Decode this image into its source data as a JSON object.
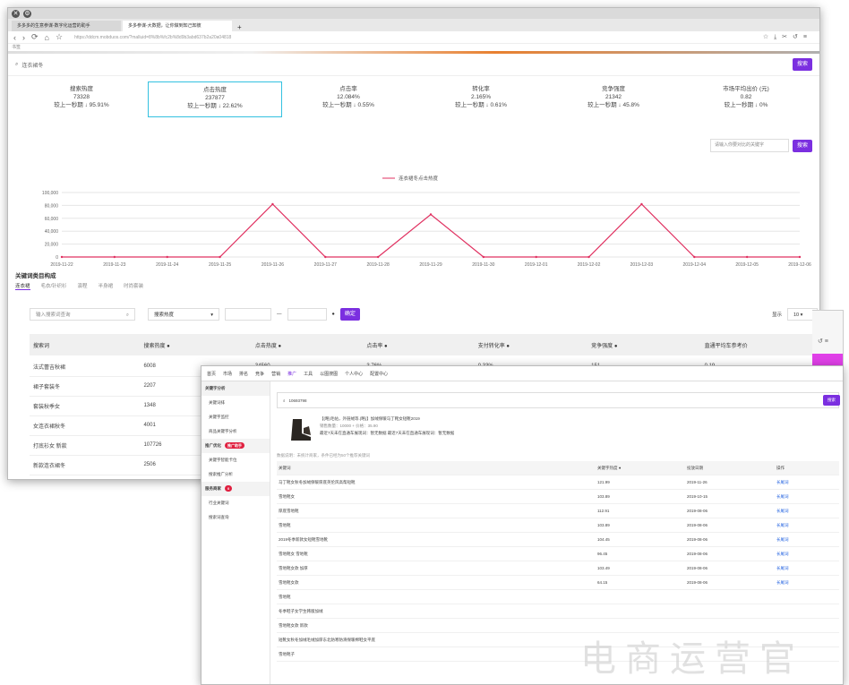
{
  "browser": {
    "tab1_title": "多多多的生意参谋-数字化运营的助手",
    "tab2_title": "多多参谋-大数据，让你做到知己知彼",
    "new_tab": "+",
    "url": "https://ddcm.mobduos.com/?malluid=8%8b%fc2b%8d9b3abd637b2a20a04818",
    "bookmark": "书签"
  },
  "search": {
    "query": "连衣裙冬",
    "button": "搜索"
  },
  "metrics": [
    {
      "label": "搜索热度",
      "value": "73328",
      "change": "较上一秒期 ↓ 95.91%"
    },
    {
      "label": "点击热度",
      "value": "237877",
      "change": "较上一秒期 ↓ 22.62%"
    },
    {
      "label": "点击率",
      "value": "12.084%",
      "change": "较上一秒期 ↓ 0.55%"
    },
    {
      "label": "转化率",
      "value": "2.165%",
      "change": "较上一秒期 ↓ 0.61%"
    },
    {
      "label": "竞争强度",
      "value": "21342",
      "change": "较上一秒期 ↓ 45.8%"
    },
    {
      "label": "市场平均出价 (元)",
      "value": "0.82",
      "change": "较上一秒期 ↓ 0%"
    }
  ],
  "compare": {
    "placeholder": "请输入你要对比的关键字",
    "button": "搜索"
  },
  "chart_data": {
    "type": "line",
    "legend": "连衣裙冬点击热度",
    "categories": [
      "2019-11-22",
      "2019-11-23",
      "2019-11-24",
      "2019-11-25",
      "2019-11-26",
      "2019-11-27",
      "2019-11-28",
      "2019-11-29",
      "2019-11-30",
      "2019-12-01",
      "2019-12-02",
      "2019-12-03",
      "2019-12-04",
      "2019-12-05",
      "2019-12-06"
    ],
    "values": [
      0,
      0,
      0,
      0,
      82000,
      0,
      0,
      66000,
      0,
      0,
      0,
      82000,
      0,
      0,
      0
    ],
    "yticks": [
      "0",
      "20,000",
      "40,000",
      "60,000",
      "80,000",
      "100,000"
    ],
    "ylim": [
      0,
      100000
    ],
    "series_color": "#e03060"
  },
  "section": {
    "title": "关键词类目构成",
    "tabs": [
      "连衣裙",
      "毛衣/针织衫",
      "演程",
      "半身裙",
      "时尚套装"
    ]
  },
  "filters": {
    "keyword_placeholder": "输入搜索词查询",
    "select_value": "搜索热度",
    "confirm": "确定",
    "show_label": "显示",
    "page_size": "10"
  },
  "table": {
    "headers": [
      "搜索词",
      "搜索热度",
      "点击热度",
      "点击率",
      "支付转化率",
      "竞争强度",
      "直通平均车参考价"
    ],
    "rows": [
      [
        "法式蕾吉秋裙",
        "6008",
        "34560",
        "3.76%",
        "0.33%",
        "151",
        "0.19"
      ],
      [
        "裙子套装冬",
        "2207",
        "",
        "",
        "",
        "",
        ""
      ],
      [
        "套装秋季女",
        "1348",
        "",
        "",
        "",
        "",
        ""
      ],
      [
        "女连衣裙秋冬",
        "4001",
        "",
        "",
        "",
        "",
        ""
      ],
      [
        "打底衫女 新款",
        "107726",
        "",
        "",
        "",
        "",
        ""
      ],
      [
        "新款连衣裙冬",
        "2506",
        "",
        "",
        "",
        "",
        ""
      ]
    ]
  },
  "w2": {
    "nav": [
      "首页",
      "市场",
      "排名",
      "竞争",
      "营销",
      "推广",
      "工具",
      "以图搜图",
      "个人中心",
      "配置中心"
    ],
    "side": [
      {
        "type": "group",
        "label": "关键字分析"
      },
      {
        "type": "item",
        "label": "关键词排"
      },
      {
        "type": "item",
        "label": "关键字监控"
      },
      {
        "type": "item",
        "label": "商品关键字分析"
      },
      {
        "type": "group",
        "label": "推广优化",
        "badge": "推广助手"
      },
      {
        "type": "item",
        "label": "关键字智能卡位"
      },
      {
        "type": "item",
        "label": "搜索推广分析"
      },
      {
        "type": "group",
        "label": "服务商家",
        "badge": "0"
      },
      {
        "type": "item",
        "label": "行业关键词"
      },
      {
        "type": "item",
        "label": "搜索词查询"
      }
    ],
    "search_value": "10693798",
    "product_title": "【(略)毛帖，外链绒等.(略)】加绒保暖马丁靴女短靴2019",
    "product_line2": "销售数量：10000 + 价格：35.90",
    "product_line3": "最近7天未在直通车展现词：暂无数据    最近7天未在直通车展现词：暂无数据",
    "hint": "数据说明：未统计商家，条件已经为50个推荐关键词",
    "headers": [
      "关键词",
      "关键字热度",
      "投放日期",
      "操作"
    ],
    "rows": [
      [
        "马丁靴女秋冬加绒保暖厚底英伦风高帮短靴",
        "121.99",
        "2019-11-26",
        "长尾词"
      ],
      [
        "雪地靴女",
        "103.89",
        "2019-10-15",
        "长尾词"
      ],
      [
        "厚底雪地靴",
        "112.91",
        "2019-08-06",
        "长尾词"
      ],
      [
        "雪地靴",
        "103.89",
        "2019-08-06",
        "长尾词"
      ],
      [
        "2019冬季新款女短靴雪地靴",
        "104.45",
        "2019-08-06",
        "长尾词"
      ],
      [
        "雪地靴女 雪地靴",
        "96.45",
        "2019-08-06",
        "长尾词"
      ],
      [
        "雪地靴女款 加厚",
        "103.49",
        "2019-08-06",
        "长尾词"
      ],
      [
        "雪地靴女款",
        "64.15",
        "2019-08-06",
        "长尾词"
      ],
      [
        "雪地靴",
        "",
        "",
        ""
      ],
      [
        "冬季鞋子女学生韩版加绒",
        "",
        "",
        ""
      ],
      [
        "雪地靴女款 新款",
        "",
        "",
        ""
      ],
      [
        "短靴女秋冬加绒毛绒加厚东北防寒防滑保暖棉鞋女平底",
        "",
        "",
        ""
      ],
      [
        "雪地靴子",
        "",
        "",
        ""
      ]
    ],
    "search_button": "搜索"
  },
  "watermark": "电商运营官"
}
